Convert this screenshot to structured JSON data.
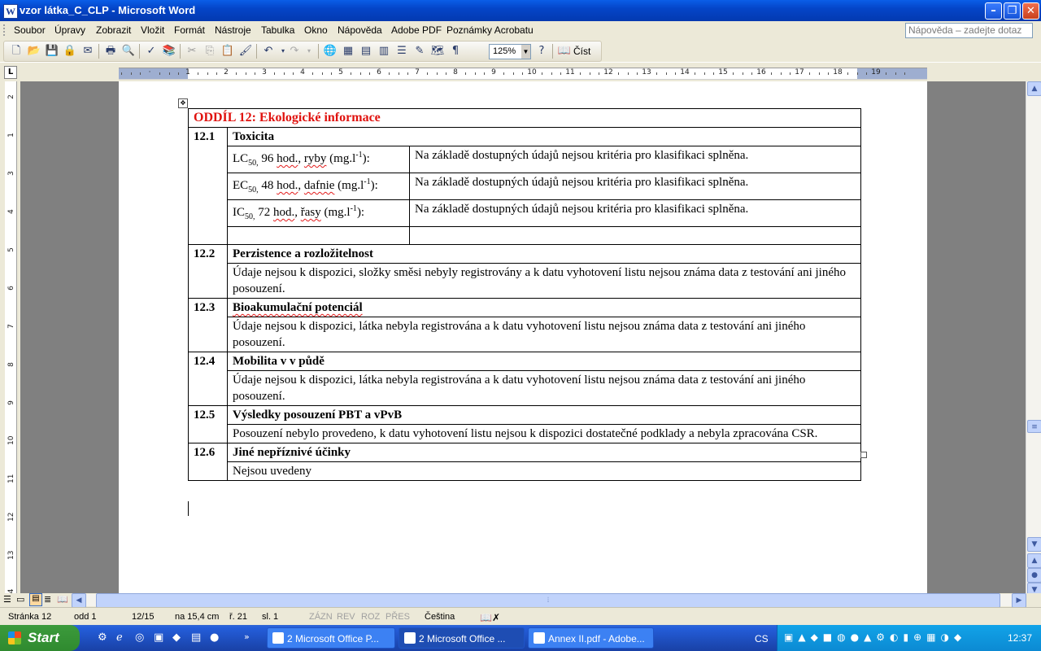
{
  "window": {
    "title": "vzor látka_C_CLP - Microsoft Word",
    "app_icon": "W"
  },
  "menubar": {
    "items": [
      "Soubor",
      "Úpravy",
      "Zobrazit",
      "Vložit",
      "Formát",
      "Nástroje",
      "Tabulka",
      "Okno",
      "Nápověda",
      "Adobe PDF",
      "Poznámky Acrobatu"
    ],
    "help_placeholder": "Nápověda – zadejte dotaz"
  },
  "toolbar": {
    "zoom": "125%",
    "read_label": "Číst"
  },
  "ruler": {
    "labels": [
      "1",
      "·",
      "1",
      "2",
      "3",
      "4",
      "5",
      "6",
      "7",
      "8",
      "9",
      "10",
      "11",
      "12",
      "13",
      "14",
      "15",
      "16",
      "17",
      "18",
      "19"
    ]
  },
  "vruler": {
    "labels": [
      "2",
      "1",
      "3",
      "4",
      "5",
      "6",
      "7",
      "8",
      "9",
      "10",
      "11",
      "12",
      "13",
      "14"
    ]
  },
  "document": {
    "section_title": "ODDÍL 12: Ekologické informace",
    "s1": {
      "num": "12.1",
      "title": "Toxicita"
    },
    "tox_rows": [
      {
        "label_pre": "LC",
        "label_sub": "50,",
        "label_post": " 96 ",
        "label_hod": "hod.",
        "label_org_pre": ", ",
        "label_org": "ryby",
        "label_unit": " (mg.l",
        "label_sup": "-1",
        "label_end": "):",
        "value": "Na základě dostupných údajů nejsou kritéria pro klasifikaci splněna."
      },
      {
        "label_pre": "EC",
        "label_sub": "50,",
        "label_post": " 48 ",
        "label_hod": "hod.",
        "label_org_pre": ", ",
        "label_org": "dafnie",
        "label_unit": " (mg.l",
        "label_sup": "-1",
        "label_end": "):",
        "value": "Na základě dostupných údajů nejsou kritéria pro klasifikaci splněna."
      },
      {
        "label_pre": "IC",
        "label_sub": "50,",
        "label_post": " 72 ",
        "label_hod": "hod.",
        "label_org_pre": ", ",
        "label_org": "řasy",
        "label_unit": " (mg.l",
        "label_sup": "-1",
        "label_end": "):",
        "value": "Na základě dostupných údajů nejsou kritéria pro klasifikaci splněna."
      }
    ],
    "s2": {
      "num": "12.2",
      "title": "Perzistence a rozložitelnost",
      "text": "Údaje nejsou k dispozici, složky směsi nebyly registrovány a k datu vyhotovení listu nejsou známa data z testování ani jiného posouzení."
    },
    "s3": {
      "num": "12.3",
      "title": "Bioakumulační potenciál",
      "text": "Údaje nejsou k dispozici, látka nebyla registrována a k datu vyhotovení listu nejsou známa data z testování ani jiného posouzení."
    },
    "s4": {
      "num": "12.4",
      "title": "Mobilita v v půdě",
      "text": "Údaje nejsou k dispozici, látka nebyla registrována a k datu vyhotovení listu nejsou známa data z testování ani jiného posouzení."
    },
    "s5": {
      "num": "12.5",
      "title": "Výsledky posouzení PBT a vPvB",
      "text": "Posouzení nebylo provedeno, k datu vyhotovení listu nejsou k dispozici dostatečné podklady a nebyla zpracována CSR."
    },
    "s6": {
      "num": "12.6",
      "title": "Jiné nepříznivé účinky",
      "text": "Nejsou uvedeny"
    }
  },
  "statusbar": {
    "page": "Stránka  12",
    "section": "odd  1",
    "pages": "12/15",
    "at": "na  15,4 cm",
    "line": "ř.  21",
    "col": "sl.  1",
    "rec": "ZÁZN",
    "trk": "REV",
    "ext": "ROZ",
    "ovr": "PŘES",
    "lang": "Čeština"
  },
  "taskbar": {
    "start": "Start",
    "tasks": [
      "2 Microsoft Office P...",
      "2 Microsoft Office ...",
      "Annex II.pdf - Adobe..."
    ],
    "lang": "CS",
    "clock": "12:37"
  }
}
